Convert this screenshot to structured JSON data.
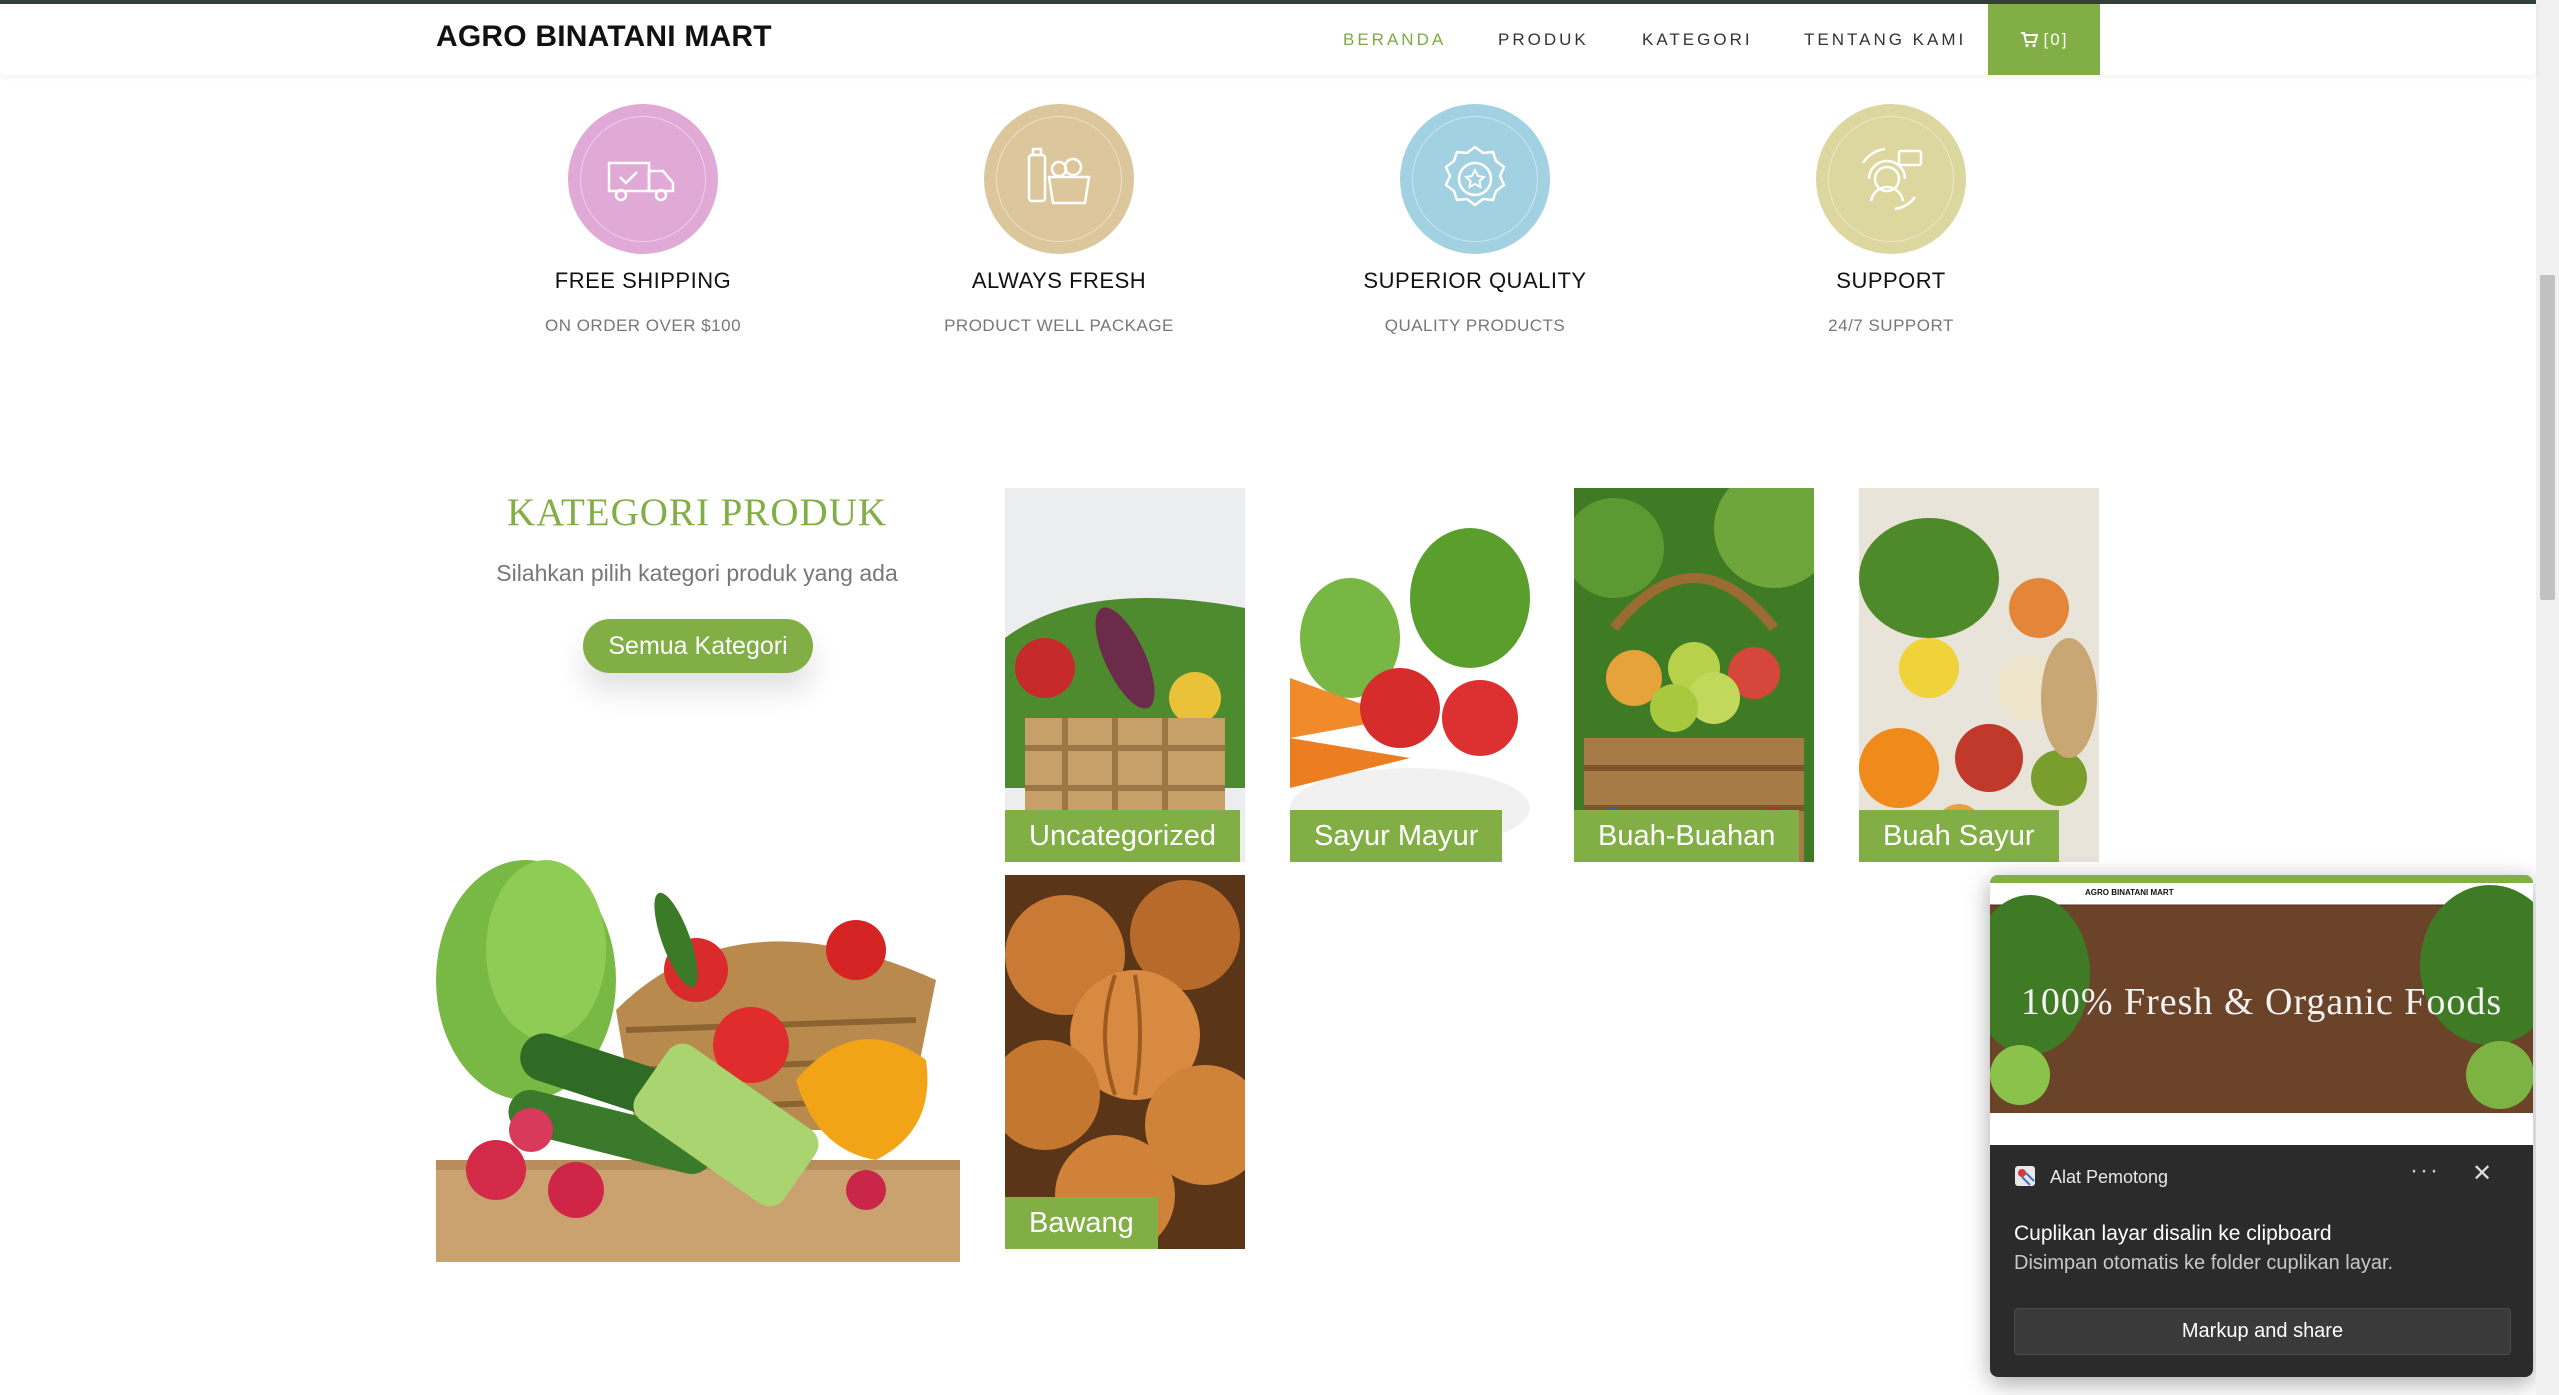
{
  "navbar": {
    "brand": "AGRO BINATANI MART",
    "items": [
      {
        "label": "BERANDA",
        "active": true
      },
      {
        "label": "PRODUK",
        "active": false
      },
      {
        "label": "KATEGORI",
        "active": false
      },
      {
        "label": "TENTANG KAMI",
        "active": false
      }
    ],
    "cart_label": "[0]"
  },
  "features": [
    {
      "title": "FREE SHIPPING",
      "subtitle": "ON ORDER OVER $100",
      "icon": "delivery-truck-icon",
      "color": "#e1a9d6"
    },
    {
      "title": "ALWAYS FRESH",
      "subtitle": "PRODUCT WELL PACKAGE",
      "icon": "grocery-bag-icon",
      "color": "#dcc69c"
    },
    {
      "title": "SUPERIOR QUALITY",
      "subtitle": "QUALITY PRODUCTS",
      "icon": "quality-badge-icon",
      "color": "#a2d1e1"
    },
    {
      "title": "SUPPORT",
      "subtitle": "24/7 SUPPORT",
      "icon": "support-agent-icon",
      "color": "#dcd69f"
    }
  ],
  "kategori": {
    "heading": "KATEGORI PRODUK",
    "subtitle": "Silahkan pilih kategori produk yang ada",
    "button": "Semua Kategori",
    "cards": [
      {
        "label": "Uncategorized"
      },
      {
        "label": "Sayur Mayur"
      },
      {
        "label": "Buah-Buahan"
      },
      {
        "label": "Buah Sayur"
      },
      {
        "label": "Bawang"
      }
    ]
  },
  "notification": {
    "app_name": "Alat Pemotong",
    "title": "Cuplikan layar disalin ke clipboard",
    "body": "Disimpan otomatis ke folder cuplikan layar.",
    "button": "Markup and share",
    "more": "···",
    "close": "✕",
    "preview": {
      "brand": "AGRO BINATANI MART",
      "headline": "100% Fresh & Organic Foods"
    }
  },
  "colors": {
    "accent": "#82ae46",
    "nav_active": "#7aab42"
  }
}
